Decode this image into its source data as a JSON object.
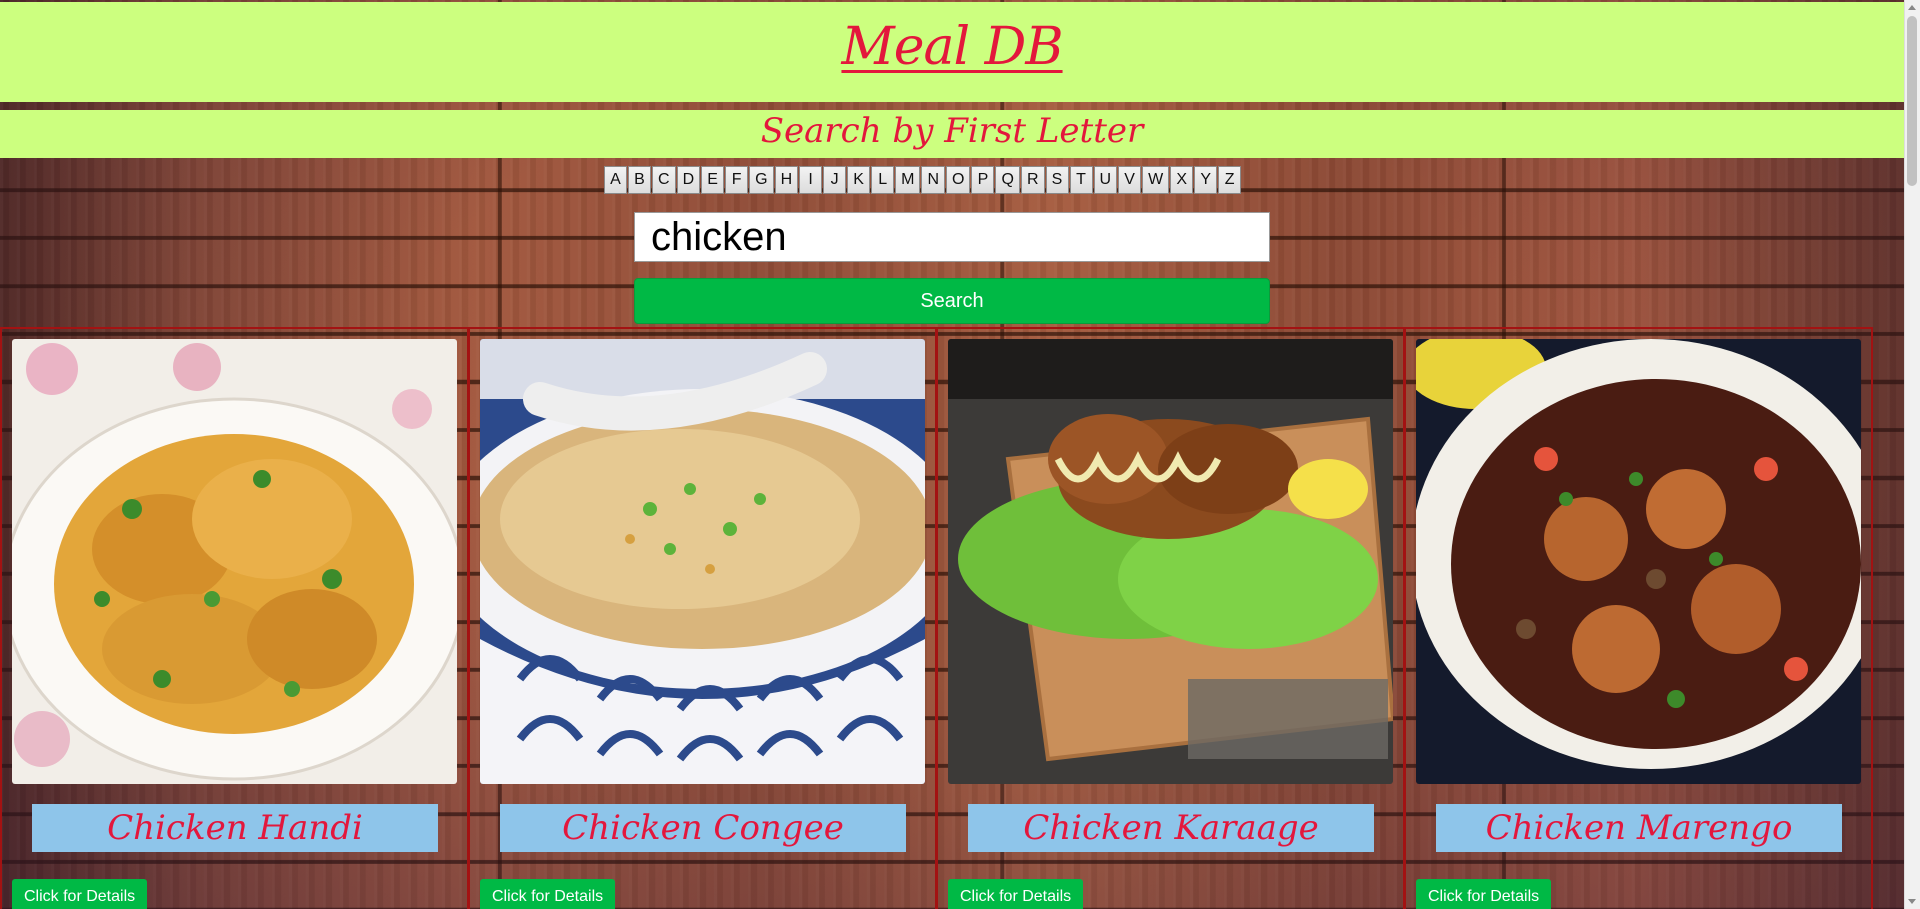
{
  "header": {
    "title": "Meal DB"
  },
  "subheader": {
    "title": "Search by First Letter"
  },
  "letters": [
    "A",
    "B",
    "C",
    "D",
    "E",
    "F",
    "G",
    "H",
    "I",
    "J",
    "K",
    "L",
    "M",
    "N",
    "O",
    "P",
    "Q",
    "R",
    "S",
    "T",
    "U",
    "V",
    "W",
    "X",
    "Y",
    "Z"
  ],
  "search": {
    "value": "chicken",
    "button_label": "Search"
  },
  "meals": [
    {
      "name": "Chicken Handi",
      "button_label": "Click for Details",
      "image": "chicken-handi-photo"
    },
    {
      "name": "Chicken Congee",
      "button_label": "Click for Details",
      "image": "chicken-congee-photo"
    },
    {
      "name": "Chicken Karaage",
      "button_label": "Click for Details",
      "image": "chicken-karaage-photo"
    },
    {
      "name": "Chicken Marengo",
      "button_label": "Click for Details",
      "image": "chicken-marengo-photo"
    }
  ],
  "colors": {
    "banner": "#ccff7f",
    "title_red": "#e3173c",
    "button_green": "#00b945",
    "name_bg": "#8ec5ea",
    "card_border": "#a31212"
  }
}
